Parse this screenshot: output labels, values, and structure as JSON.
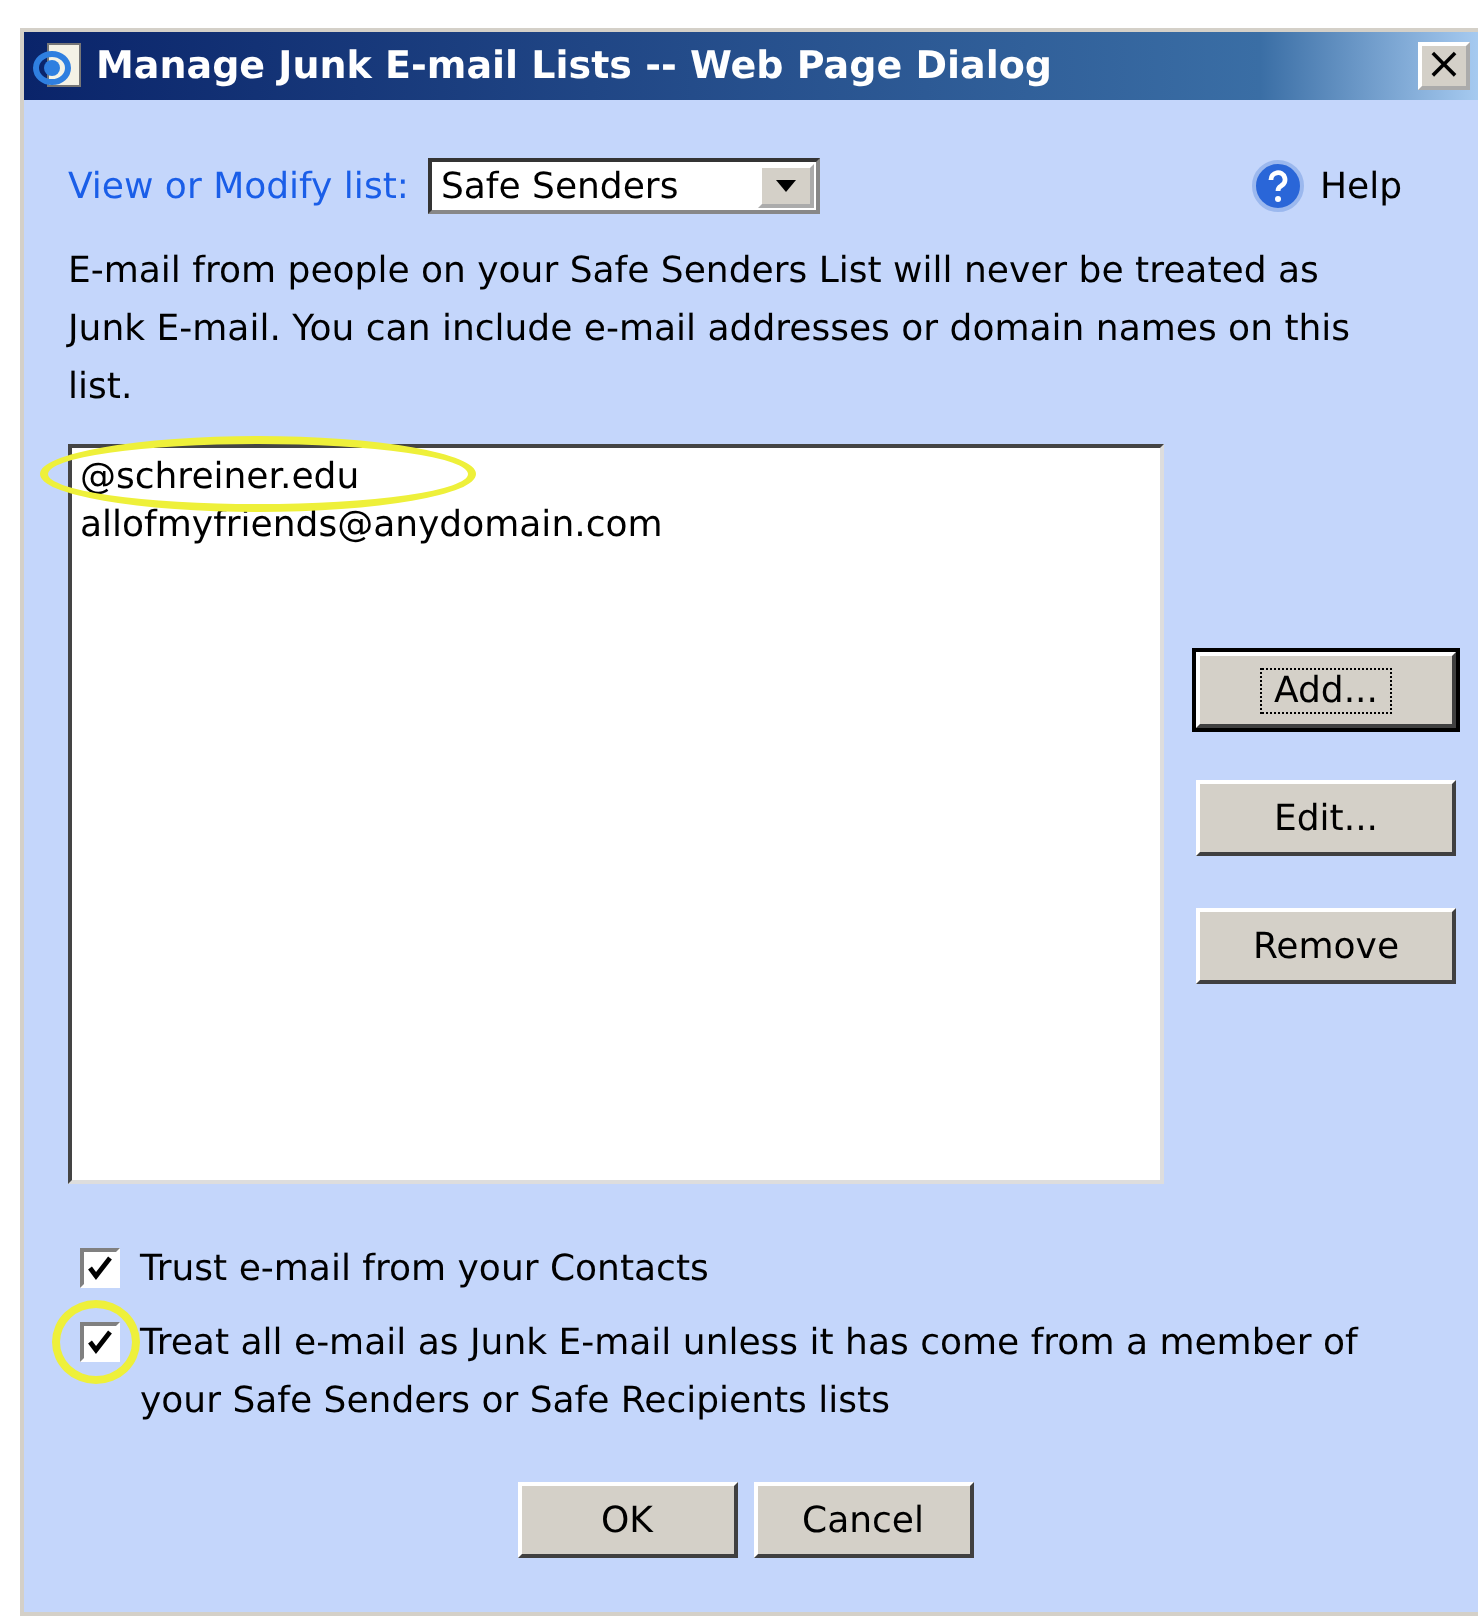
{
  "window": {
    "title": "Manage Junk E-mail Lists -- Web Page Dialog",
    "close": "×"
  },
  "list_selector": {
    "label": "View or Modify list:",
    "value": "Safe Senders"
  },
  "help": {
    "label": "Help"
  },
  "description": "E-mail from people on your Safe Senders List will never be treated as Junk E-mail. You can include e-mail addresses or domain names on this list.",
  "entries": [
    {
      "text": "@schreiner.edu",
      "highlighted": true
    },
    {
      "text": "allofmyfriends@anydomain.com",
      "highlighted": false
    }
  ],
  "side_buttons": [
    {
      "label": "Add...",
      "focused": true
    },
    {
      "label": "Edit...",
      "focused": false
    },
    {
      "label": "Remove",
      "focused": false
    }
  ],
  "options": [
    {
      "label": "Trust e-mail from your Contacts",
      "checked": true,
      "highlighted": false
    },
    {
      "label": "Treat all e-mail as Junk E-mail unless it has come from a member of your Safe Senders or Safe Recipients lists",
      "checked": true,
      "highlighted": true
    }
  ],
  "buttons": [
    "OK",
    "Cancel"
  ]
}
